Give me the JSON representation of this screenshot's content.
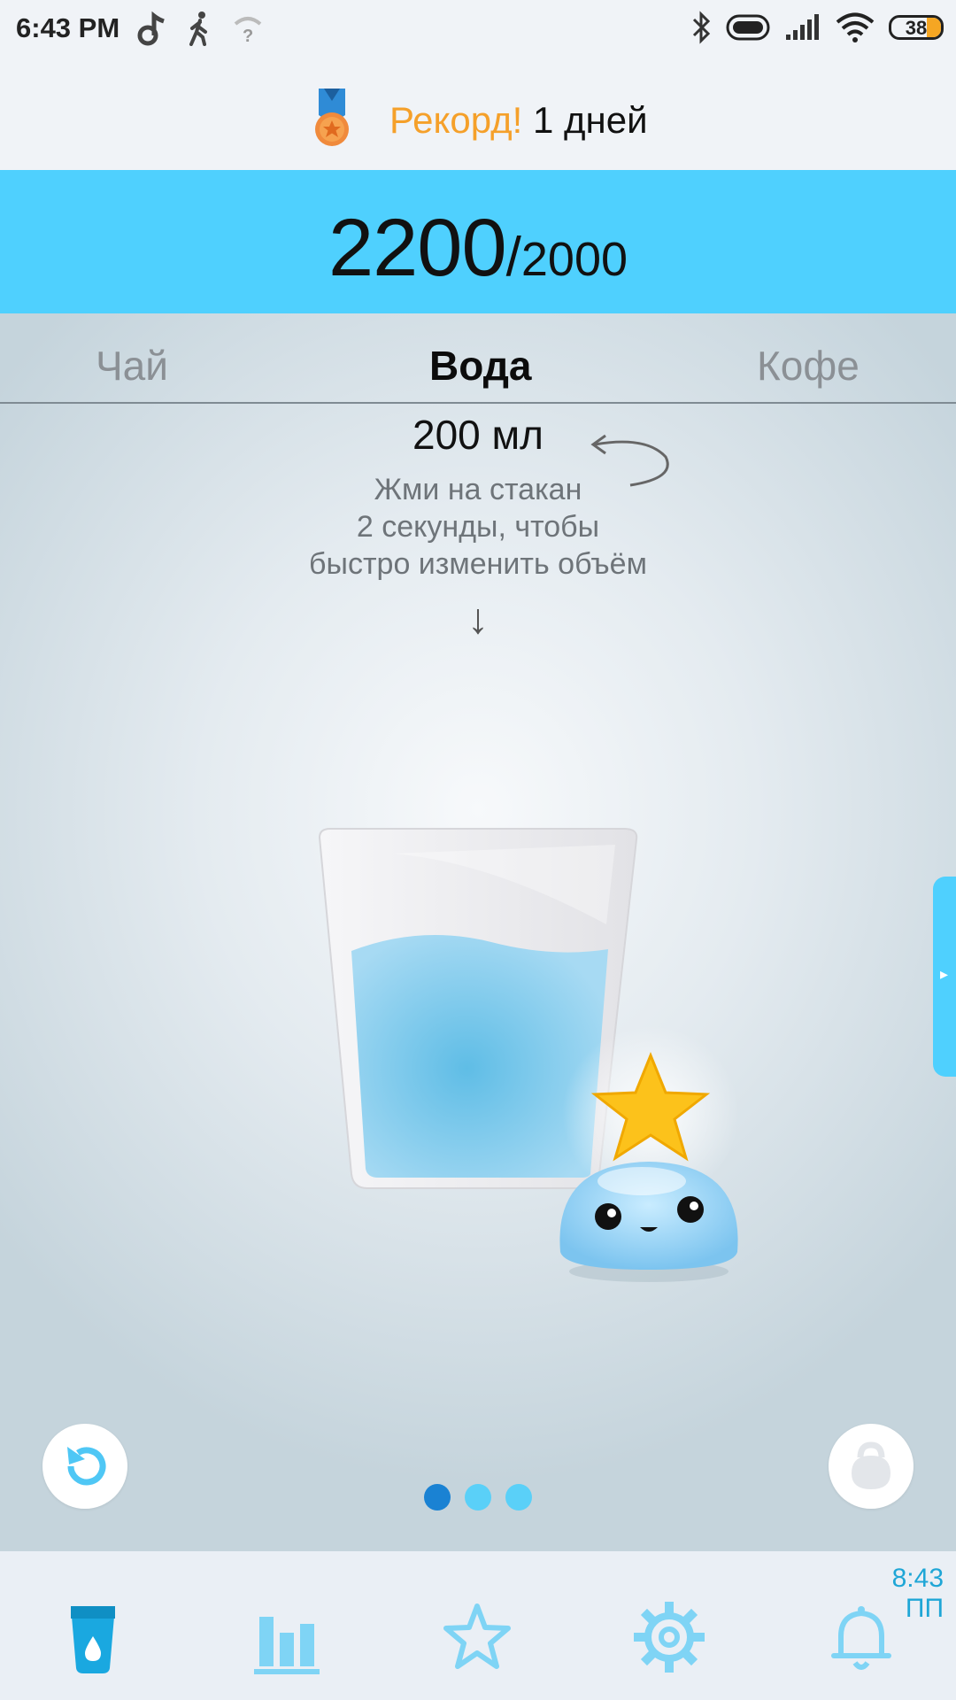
{
  "status_bar": {
    "time": "6:43 PM",
    "battery_level": "38",
    "icons": [
      "music-note-icon",
      "walking-icon",
      "wifi-question-icon",
      "bluetooth-icon",
      "toggle-icon",
      "signal-icon",
      "wifi-icon",
      "battery-icon"
    ]
  },
  "record": {
    "label": "Рекорд!",
    "value": "1 дней"
  },
  "progress": {
    "current": "2200",
    "separator": "/",
    "goal": "2000"
  },
  "tabs": [
    {
      "label": "Чай",
      "active": false
    },
    {
      "label": "Вода",
      "active": true
    },
    {
      "label": "Кофе",
      "active": false
    }
  ],
  "volume": "200 мл",
  "hint": {
    "line1": "Жми на стакан",
    "line2": "2 секунды, чтобы",
    "line3": "быстро изменить объём"
  },
  "down_arrow": "↓",
  "pager": {
    "count": 3,
    "active_index": 0
  },
  "bottom_nav": {
    "items": [
      "drink-icon",
      "stats-icon",
      "star-icon",
      "settings-icon",
      "bell-icon"
    ],
    "active_index": 0,
    "clock_time": "8:43",
    "clock_suffix": "ПП"
  },
  "colors": {
    "accent": "#4fd0fe",
    "record_orange": "#f5a02a",
    "active_dot": "#1a82d3",
    "nav_icon": "#7fd4f5",
    "nav_active": "#1aa8e0"
  }
}
